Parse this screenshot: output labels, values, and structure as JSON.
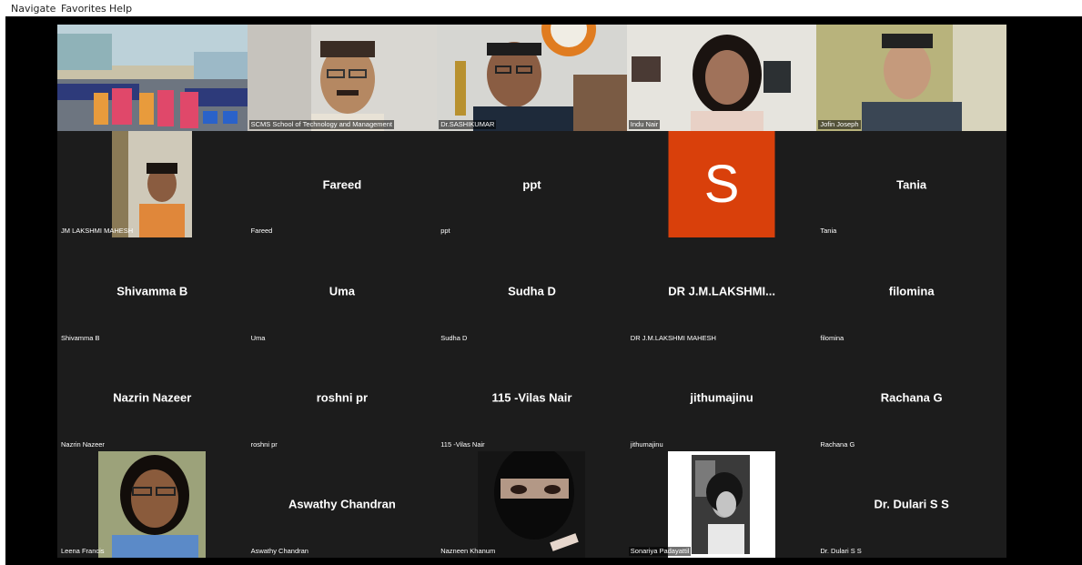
{
  "menu": {
    "items": [
      "Navigate",
      "Favorites",
      "Help"
    ]
  },
  "colors": {
    "stage": "#000000",
    "tile": "#1c1c1c",
    "avatar_s": "#d9400b",
    "text": "#ffffff"
  },
  "tiles": [
    {
      "name": "",
      "label": "",
      "video": "classroom"
    },
    {
      "name": "",
      "label": "SCMS School of Technology and Management",
      "video": "man-glasses"
    },
    {
      "name": "",
      "label": "Dr.SASHIKUMAR",
      "video": "man-headset"
    },
    {
      "name": "",
      "label": "Indu Nair",
      "video": "woman-glasses"
    },
    {
      "name": "",
      "label": "Jofin Joseph",
      "video": "man-young"
    },
    {
      "name": "",
      "label": "JM LAKSHMI MAHESH",
      "video": "woman-small"
    },
    {
      "name": "Fareed",
      "label": "Fareed"
    },
    {
      "name": "ppt",
      "label": "ppt"
    },
    {
      "name": "",
      "label": "",
      "avatar": "S"
    },
    {
      "name": "Tania",
      "label": "Tania"
    },
    {
      "name": "Shivamma B",
      "label": "Shivamma B"
    },
    {
      "name": "Uma",
      "label": "Uma"
    },
    {
      "name": "Sudha D",
      "label": "Sudha D"
    },
    {
      "name": "DR  J.M.LAKSHMI...",
      "label": "DR J.M.LAKSHMI MAHESH"
    },
    {
      "name": "filomina",
      "label": "filomina"
    },
    {
      "name": "Nazrin Nazeer",
      "label": "Nazrin Nazeer"
    },
    {
      "name": "roshni pr",
      "label": "roshni pr"
    },
    {
      "name": "115 -Vilas Nair",
      "label": "115 -Vilas Nair"
    },
    {
      "name": "jithumajinu",
      "label": "jithumajinu"
    },
    {
      "name": "Rachana G",
      "label": "Rachana G"
    },
    {
      "name": "",
      "label": "Leena Francis",
      "video": "woman-photo"
    },
    {
      "name": "Aswathy Chandran",
      "label": "Aswathy Chandran"
    },
    {
      "name": "",
      "label": "Nazneen Khanum",
      "video": "veiled"
    },
    {
      "name": "",
      "label": "Sonariya Padayattil",
      "video": "bw-photo"
    },
    {
      "name": "Dr. Dulari S S",
      "label": "Dr. Dulari S S"
    }
  ]
}
